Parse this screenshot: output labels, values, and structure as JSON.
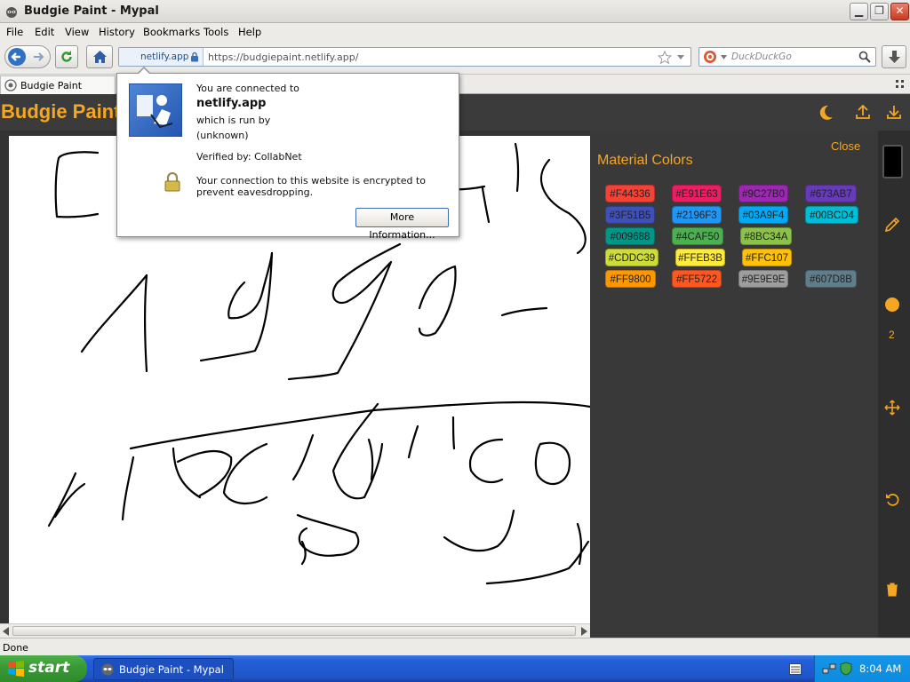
{
  "window": {
    "title": "Budgie Paint - Mypal",
    "min": "▁",
    "max": "❐",
    "close": "✕"
  },
  "menu": [
    "File",
    "Edit",
    "View",
    "History",
    "Bookmarks",
    "Tools",
    "Help"
  ],
  "navbar": {
    "identity": "netlify.app",
    "url": "https://budgiepaint.netlify.app/",
    "search_placeholder": "DuckDuckGo"
  },
  "tab": {
    "label": "Budgie Paint"
  },
  "identity_popup": {
    "connected_to": "You are connected to",
    "site": "netlify.app",
    "run_by": "which is run by",
    "owner": "(unknown)",
    "verified_by": "Verified by: CollabNet",
    "encryption": "Your connection to this website is encrypted to prevent eavesdropping.",
    "more_info": "More Information..."
  },
  "app": {
    "title": "Budgie Paint",
    "panel_close": "Close",
    "panel_title": "Material Colors",
    "brush_size": "2",
    "colors": [
      {
        "label": "#F44336",
        "hex": "#F44336"
      },
      {
        "label": "#E91E63",
        "hex": "#E91E63"
      },
      {
        "label": "#9C27B0",
        "hex": "#9C27B0"
      },
      {
        "label": "#673AB7",
        "hex": "#673AB7"
      },
      {
        "label": "#3F51B5",
        "hex": "#3F51B5"
      },
      {
        "label": "#2196F3",
        "hex": "#2196F3"
      },
      {
        "label": "#03A9F4",
        "hex": "#03A9F4"
      },
      {
        "label": "#00BCD4",
        "hex": "#00BCD4"
      },
      {
        "label": "#009688",
        "hex": "#009688"
      },
      {
        "label": "#4CAF50",
        "hex": "#4CAF50"
      },
      {
        "label": "#8BC34A",
        "hex": "#8BC34A"
      },
      {
        "label": "#CDDC39",
        "hex": "#CDDC39"
      },
      {
        "label": "#FFEB3B",
        "hex": "#FFEB3B"
      },
      {
        "label": "#FFC107",
        "hex": "#FFC107"
      },
      {
        "label": "#FF9800",
        "hex": "#FF9800"
      },
      {
        "label": "#FF5722",
        "hex": "#FF5722"
      },
      {
        "label": "#9E9E9E",
        "hex": "#9E9E9E"
      },
      {
        "label": "#607D8B",
        "hex": "#607D8B"
      }
    ],
    "accent": "#F5A623"
  },
  "status": {
    "text": "Done"
  },
  "taskbar": {
    "start": "start",
    "task": "Budgie Paint - Mypal",
    "clock": "8:04 AM"
  }
}
